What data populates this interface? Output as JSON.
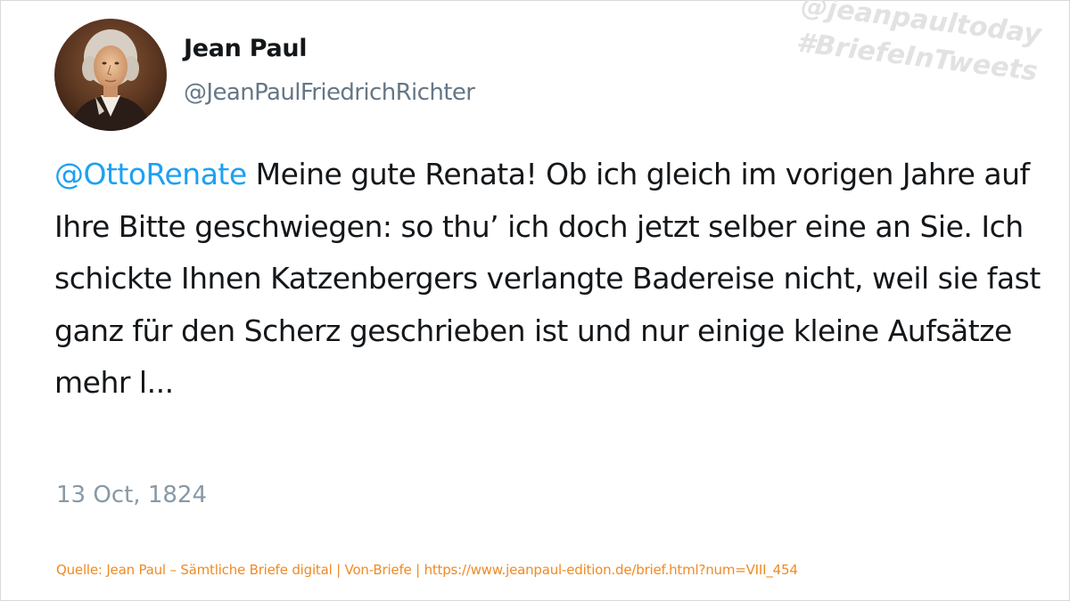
{
  "author": {
    "name": "Jean Paul",
    "handle": "@JeanPaulFriedrichRichter"
  },
  "watermark": {
    "line1": "@jeanpaultoday",
    "line2": "#BriefeInTweets"
  },
  "tweet": {
    "mention": "@OttoRenate",
    "body": "Meine gute Renata! Ob ich gleich im vorigen Jahre auf Ihre Bitte geschwiegen: so thu’ ich doch jetzt selber eine an Sie. Ich schickte Ihnen Katzenbergers verlangte Badereise nicht, weil sie fast ganz für den Scherz geschrieben ist und nur einige kleine Aufsätze mehr l...",
    "date": "13 Oct, 1824"
  },
  "source": "Quelle: Jean Paul – Sämtliche Briefe digital | Von-Briefe | https://www.jeanpaul-edition.de/brief.html?num=VIII_454",
  "colors": {
    "mention": "#1da1f2",
    "name": "#14171a",
    "handle": "#657786",
    "date": "#8899a6",
    "source": "#f08a24",
    "watermark": "#e2e2e2"
  },
  "icons": {
    "avatar": "portrait-avatar"
  }
}
